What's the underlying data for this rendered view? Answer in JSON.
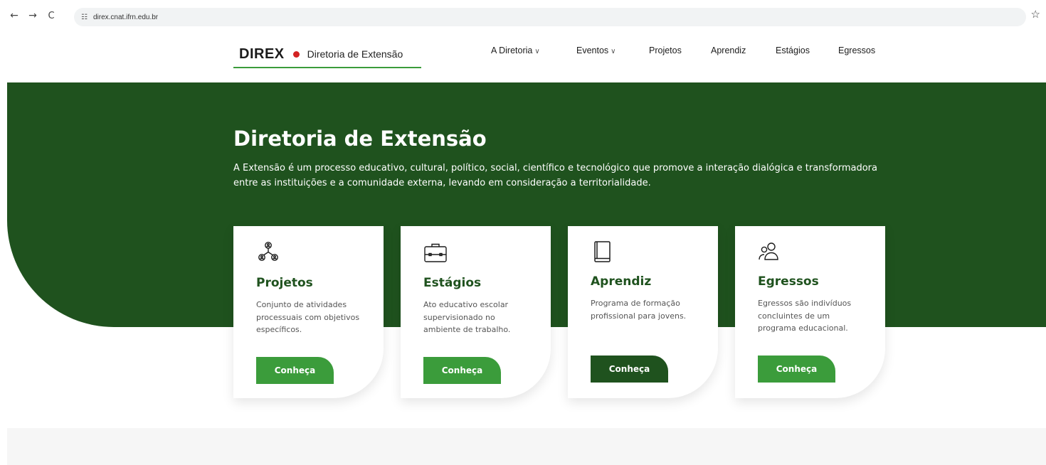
{
  "browser": {
    "back": "←",
    "forward": "→",
    "reload": "C",
    "site_icon": "☷",
    "url": "direx.cnat.ifrn.edu.br",
    "star": "☆"
  },
  "header": {
    "brand_name": "DIREX",
    "brand_sub": "Diretoria de Extensão",
    "nav": [
      {
        "label": "A Diretoria",
        "has_dropdown": true
      },
      {
        "label": "Eventos",
        "has_dropdown": true
      },
      {
        "label": "Projetos"
      },
      {
        "label": "Aprendiz"
      },
      {
        "label": "Estágios"
      },
      {
        "label": "Egressos"
      }
    ],
    "chevron": "∨"
  },
  "hero": {
    "title": "Diretoria de Extensão",
    "description": "A Extensão é um processo educativo, cultural, político, social, científico e tecnológico que promove a interação dialógica e transformadora entre as instituições e a comunidade externa, levando em consideração a territorialidade."
  },
  "cards": [
    {
      "icon": "network-people-icon",
      "title": "Projetos",
      "text": "Conjunto de atividades processuais com objetivos específicos.",
      "button": "Conheça"
    },
    {
      "icon": "briefcase-icon",
      "title": "Estágios",
      "text": "Ato educativo escolar supervisionado no ambiente de trabalho.",
      "button": "Conheça"
    },
    {
      "icon": "book-icon",
      "title": "Aprendiz",
      "text": "Programa de formação profissional para jovens.",
      "button": "Conheça"
    },
    {
      "icon": "users-icon",
      "title": "Egressos",
      "text": "Egressos são indivíduos concluintes de um programa educacional.",
      "button": "Conheça"
    }
  ],
  "colors": {
    "dark_green": "#1f521e",
    "accent_green": "#3b9c3b",
    "red_dot": "#d32222"
  }
}
